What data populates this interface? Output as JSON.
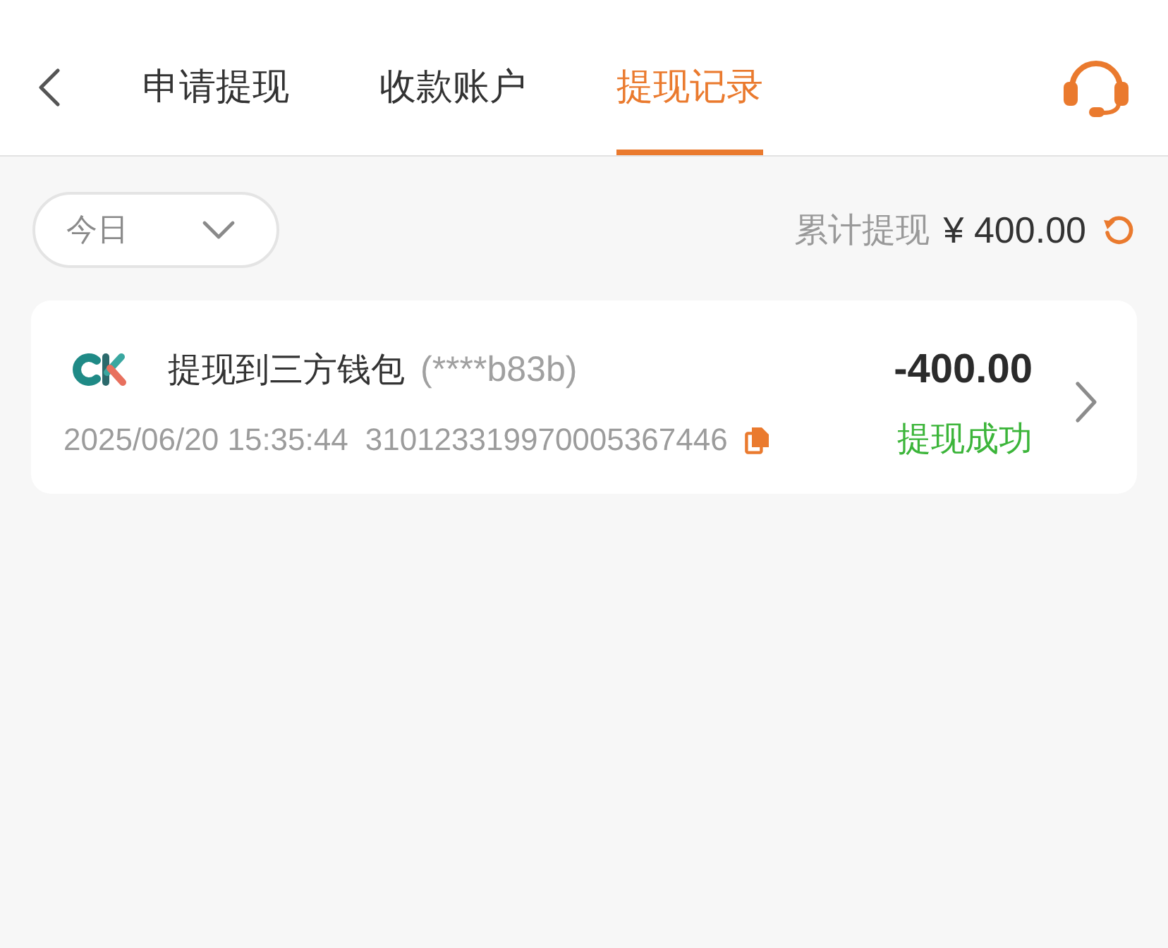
{
  "header": {
    "tabs": [
      {
        "label": "申请提现",
        "selected": false
      },
      {
        "label": "收款账户",
        "selected": false
      },
      {
        "label": "提现记录",
        "selected": true
      }
    ]
  },
  "filter": {
    "value": "今日"
  },
  "summary": {
    "label": "累计提现",
    "amount": "¥ 400.00"
  },
  "records": [
    {
      "title": "提现到三方钱包",
      "account": "(****b83b)",
      "time": "2025/06/20 15:35:44",
      "order_no": "310123319970005367446",
      "amount": "-400.00",
      "status": {
        "text": "提现成功",
        "color": "#3cb53a"
      }
    }
  ]
}
